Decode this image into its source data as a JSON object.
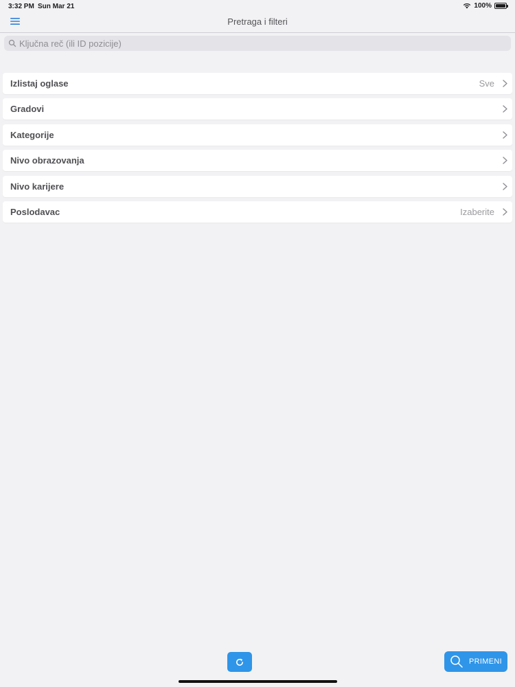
{
  "status": {
    "time": "3:32 PM",
    "date": "Sun Mar 21",
    "battery": "100%",
    "battery_level": 1.0
  },
  "nav": {
    "title": "Pretraga i filteri",
    "menu_icon": "hamburger-menu-icon"
  },
  "search": {
    "placeholder": "Ključna reč (ili ID pozicije)",
    "value": ""
  },
  "filters": [
    {
      "label": "Izlistaj oglase",
      "value": "Sve"
    },
    {
      "label": "Gradovi",
      "value": ""
    },
    {
      "label": "Kategorije",
      "value": ""
    },
    {
      "label": "Nivo obrazovanja",
      "value": ""
    },
    {
      "label": "Nivo karijere",
      "value": ""
    },
    {
      "label": "Poslodavac",
      "value": "Izaberite"
    }
  ],
  "actions": {
    "refresh_icon": "refresh-icon",
    "apply_label": "PRIMENI",
    "apply_icon": "search-icon"
  },
  "colors": {
    "accent": "#2f95e8",
    "background": "#f2f2f4"
  }
}
